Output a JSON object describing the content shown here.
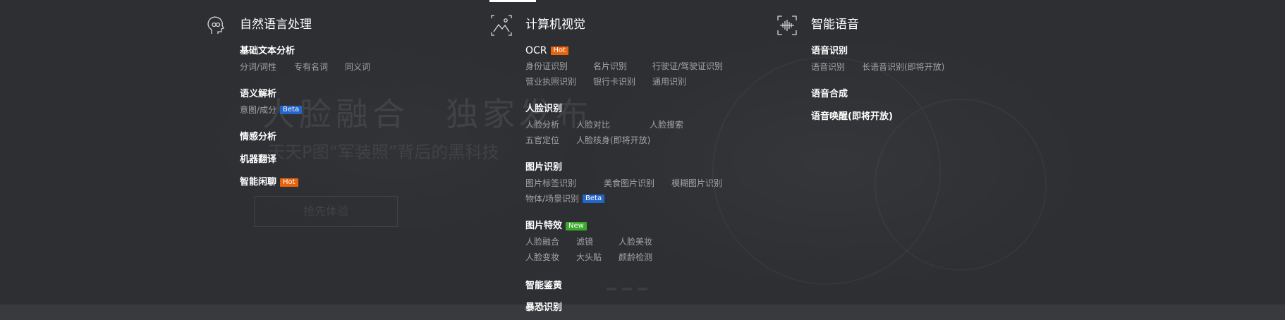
{
  "colors": {
    "background": "#2e2f33",
    "heading_text": "#ffffff",
    "item_text": "#a3a4a8",
    "badge_hot": "#e8640c",
    "badge_beta": "#2365c8",
    "badge_new": "#3aaa2c"
  },
  "background_banner": {
    "title": "人脸融合　独家发布",
    "subtitle": "天天P图“军装照”背后的黑科技",
    "cta": "抢先体验"
  },
  "columns": [
    {
      "title": "自然语言处理",
      "icon": "head-speech-icon",
      "groups": [
        {
          "title": "基础文本分析",
          "items": [
            [
              {
                "label": "分词/词性"
              },
              {
                "label": "专有名词"
              },
              {
                "label": "同义词"
              }
            ]
          ]
        },
        {
          "title": "语义解析",
          "items": [
            [
              {
                "label": "意图/成分",
                "badge": "Beta"
              }
            ]
          ]
        },
        {
          "title": "情感分析",
          "items": []
        },
        {
          "title": "机器翻译",
          "items": []
        },
        {
          "title": "智能闲聊",
          "badge": "Hot",
          "items": []
        }
      ]
    },
    {
      "title": "计算机视觉",
      "icon": "image-frame-icon",
      "groups": [
        {
          "title": "OCR",
          "badge": "Hot",
          "items": [
            [
              {
                "label": "身份证识别"
              },
              {
                "label": "名片识别"
              },
              {
                "label": "行驶证/驾驶证识别"
              }
            ],
            [
              {
                "label": "营业执照识别"
              },
              {
                "label": "银行卡识别"
              },
              {
                "label": "通用识别"
              }
            ]
          ]
        },
        {
          "title": "人脸识别",
          "items": [
            [
              {
                "label": "人脸分析"
              },
              {
                "label": "人脸对比"
              },
              {
                "label": "人脸搜索"
              }
            ],
            [
              {
                "label": "五官定位"
              },
              {
                "label": "人脸核身(即将开放)"
              }
            ]
          ]
        },
        {
          "title": "图片识别",
          "items": [
            [
              {
                "label": "图片标签识别"
              },
              {
                "label": "美食图片识别"
              },
              {
                "label": "模糊图片识别"
              }
            ],
            [
              {
                "label": "物体/场景识别",
                "badge": "Beta"
              }
            ]
          ]
        },
        {
          "title": "图片特效",
          "badge": "New",
          "items": [
            [
              {
                "label": "人脸融合"
              },
              {
                "label": "滤镜"
              },
              {
                "label": "人脸美妆"
              }
            ],
            [
              {
                "label": "人脸变妆"
              },
              {
                "label": "大头贴"
              },
              {
                "label": "颜龄检测"
              }
            ]
          ]
        },
        {
          "title": "智能鉴黄",
          "items": []
        },
        {
          "title": "暴恐识别",
          "items": []
        }
      ]
    },
    {
      "title": "智能语音",
      "icon": "voice-wave-icon",
      "groups": [
        {
          "title": "语音识别",
          "items": [
            [
              {
                "label": "语音识别"
              },
              {
                "label": "长语音识别(即将开放)"
              }
            ]
          ]
        },
        {
          "title": "语音合成",
          "items": []
        },
        {
          "title": "语音唤醒(即将开放)",
          "items": []
        }
      ]
    }
  ]
}
